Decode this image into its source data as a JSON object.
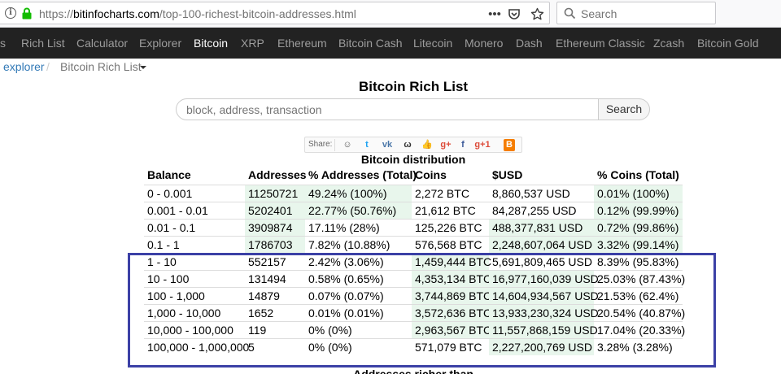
{
  "browser": {
    "url_scheme": "https://",
    "url_host": "bitinfocharts.com",
    "url_path": "/top-100-richest-bitcoin-addresses.html",
    "menu_dots": "•••",
    "search_placeholder": "Search"
  },
  "nav": {
    "items": [
      "s",
      "Rich List",
      "Calculator",
      "Explorer",
      "Bitcoin",
      "XRP",
      "Ethereum",
      "Bitcoin Cash",
      "Litecoin",
      "Monero",
      "Dash",
      "Ethereum Classic",
      "Zcash",
      "Bitcoin Gold"
    ],
    "active": "Bitcoin"
  },
  "breadcrumb": {
    "link": "explorer",
    "sep": "/",
    "current": "Bitcoin Rich List"
  },
  "page": {
    "title": "Bitcoin Rich List",
    "search_placeholder": "block, address, transaction",
    "search_button": "Search",
    "share_label": "Share:",
    "distribution_title": "Bitcoin distribution",
    "next_section_title": "Addresses richer than"
  },
  "share_icons": [
    {
      "name": "reddit-icon",
      "glyph": "☺",
      "color": "#555"
    },
    {
      "name": "twitter-icon",
      "glyph": "t",
      "color": "#1da1f2"
    },
    {
      "name": "vk-icon",
      "glyph": "vk",
      "color": "#4a76a8"
    },
    {
      "name": "weibo-icon",
      "glyph": "ω",
      "color": "#333"
    },
    {
      "name": "like-icon",
      "glyph": "👍",
      "color": "#3b5998"
    },
    {
      "name": "google-plus-icon",
      "glyph": "g+",
      "color": "#dd4b39"
    },
    {
      "name": "facebook-icon",
      "glyph": "f",
      "color": "#3b5998"
    },
    {
      "name": "google-plus-one-icon",
      "glyph": "g+1",
      "color": "#dd4b39"
    },
    {
      "name": "blogger-icon",
      "glyph": "B",
      "color": "#f57d00"
    }
  ],
  "table": {
    "headers": [
      "Balance",
      "Addresses",
      "% Addresses (Total)",
      "Coins",
      "$USD",
      "% Coins (Total)"
    ],
    "rows": [
      [
        "0 - 0.001",
        "11250721",
        "49.24% (100%)",
        "2,272 BTC",
        "8,860,537 USD",
        "0.01% (100%)"
      ],
      [
        "0.001 - 0.01",
        "5202401",
        "22.77% (50.76%)",
        "21,612 BTC",
        "84,287,255 USD",
        "0.12% (99.99%)"
      ],
      [
        "0.01 - 0.1",
        "3909874",
        "17.11% (28%)",
        "125,226 BTC",
        "488,377,831 USD",
        "0.72% (99.86%)"
      ],
      [
        "0.1 - 1",
        "1786703",
        "7.82% (10.88%)",
        "576,568 BTC",
        "2,248,607,064 USD",
        "3.32% (99.14%)"
      ],
      [
        "1 - 10",
        "552157",
        "2.42% (3.06%)",
        "1,459,444 BTC",
        "5,691,809,465 USD",
        "8.39% (95.83%)"
      ],
      [
        "10 - 100",
        "131494",
        "0.58% (0.65%)",
        "4,353,134 BTC",
        "16,977,160,039 USD",
        "25.03% (87.43%)"
      ],
      [
        "100 - 1,000",
        "14879",
        "0.07% (0.07%)",
        "3,744,869 BTC",
        "14,604,934,567 USD",
        "21.53% (62.4%)"
      ],
      [
        "1,000 - 10,000",
        "1652",
        "0.01% (0.01%)",
        "3,572,636 BTC",
        "13,933,230,324 USD",
        "20.54% (40.87%)"
      ],
      [
        "10,000 - 100,000",
        "119",
        "0% (0%)",
        "2,963,567 BTC",
        "11,557,868,159 USD",
        "17.04% (20.33%)"
      ],
      [
        "100,000 - 1,000,000",
        "5",
        "0% (0%)",
        "571,079 BTC",
        "2,227,200,769 USD",
        "3.28% (3.28%)"
      ]
    ],
    "highlight": [
      [
        false,
        true,
        true,
        false,
        false,
        true
      ],
      [
        false,
        true,
        true,
        false,
        false,
        true
      ],
      [
        false,
        true,
        false,
        false,
        true,
        true
      ],
      [
        false,
        true,
        false,
        false,
        true,
        true
      ],
      [
        false,
        false,
        false,
        true,
        false,
        false
      ],
      [
        false,
        false,
        false,
        true,
        true,
        false
      ],
      [
        false,
        false,
        false,
        true,
        true,
        false
      ],
      [
        false,
        false,
        false,
        true,
        true,
        false
      ],
      [
        false,
        false,
        false,
        true,
        true,
        false
      ],
      [
        false,
        false,
        false,
        false,
        true,
        false
      ]
    ]
  },
  "colors": {
    "frame": "#3b40a6",
    "cell_highlight": "#e8f6ec",
    "nav_bg": "#222222",
    "lock_green": "#12bc00"
  }
}
